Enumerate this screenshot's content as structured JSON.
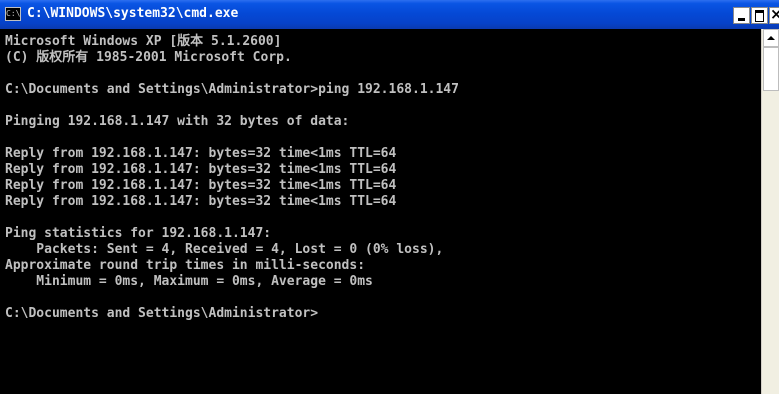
{
  "window": {
    "title": "C:\\WINDOWS\\system32\\cmd.exe",
    "icon_label": "C:\\",
    "icon": "console-app-icon"
  },
  "controls": {
    "minimize_icon": "minimize-icon",
    "maximize_icon": "maximize-icon",
    "close_icon": "close-icon"
  },
  "console": {
    "lines": [
      "Microsoft Windows XP [版本 5.1.2600]",
      "(C) 版权所有 1985-2001 Microsoft Corp.",
      "",
      "C:\\Documents and Settings\\Administrator>ping 192.168.1.147",
      "",
      "Pinging 192.168.1.147 with 32 bytes of data:",
      "",
      "Reply from 192.168.1.147: bytes=32 time<1ms TTL=64",
      "Reply from 192.168.1.147: bytes=32 time<1ms TTL=64",
      "Reply from 192.168.1.147: bytes=32 time<1ms TTL=64",
      "Reply from 192.168.1.147: bytes=32 time<1ms TTL=64",
      "",
      "Ping statistics for 192.168.1.147:",
      "    Packets: Sent = 4, Received = 4, Lost = 0 (0% loss),",
      "Approximate round trip times in milli-seconds:",
      "    Minimum = 0ms, Maximum = 0ms, Average = 0ms",
      "",
      "C:\\Documents and Settings\\Administrator>"
    ]
  },
  "colors": {
    "console_bg": "#000000",
    "console_text": "#c0c0c0",
    "titlebar": "#0549d6"
  }
}
